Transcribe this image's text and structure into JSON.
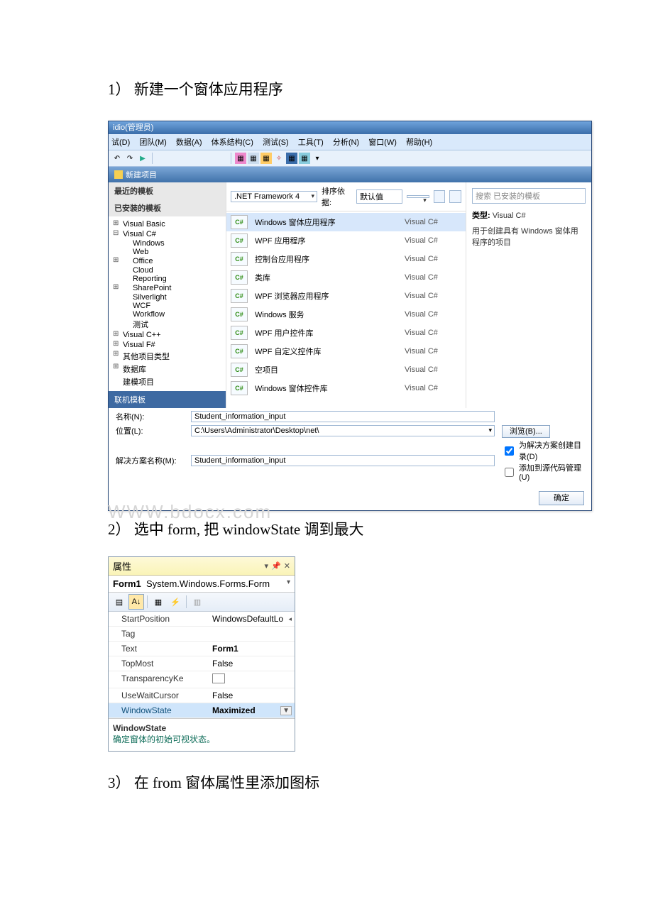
{
  "steps": {
    "s1": "1） 新建一个窗体应用程序",
    "s2": "2） 选中 form, 把 windowState 调到最大",
    "s3": "3） 在 from 窗体属性里添加图标"
  },
  "watermark": "WWW.bdocx.com",
  "newproj": {
    "titlebar": "idio(管理员)",
    "menu": {
      "debug": "试(D)",
      "team": "团队(M)",
      "data": "数据(A)",
      "arch": "体系结构(C)",
      "test": "测试(S)",
      "tools": "工具(T)",
      "analyze": "分析(N)",
      "window": "窗口(W)",
      "help": "帮助(H)"
    },
    "tab": "新建项目",
    "left": {
      "hdr_recent": "最近的模板",
      "hdr_installed": "已安装的模板",
      "items": {
        "vb": "Visual Basic",
        "cs": "Visual C#",
        "win": "Windows",
        "web": "Web",
        "office": "Office",
        "cloud": "Cloud",
        "reporting": "Reporting",
        "sharepoint": "SharePoint",
        "silverlight": "Silverlight",
        "wcf": "WCF",
        "workflow": "Workflow",
        "test": "测试",
        "cpp": "Visual C++",
        "fsharp": "Visual F#",
        "other_types": "其他项目类型",
        "database": "数据库",
        "modeling": "建模项目"
      },
      "footer": "联机模板"
    },
    "mid": {
      "framework": ".NET Framework 4",
      "sort_label": "排序依据:",
      "sort_value": "默认值",
      "templates": [
        {
          "name": "Windows 窗体应用程序",
          "lang": "Visual C#",
          "icon": "C#",
          "sel": true
        },
        {
          "name": "WPF 应用程序",
          "lang": "Visual C#",
          "icon": "C#"
        },
        {
          "name": "控制台应用程序",
          "lang": "Visual C#",
          "icon": "C#"
        },
        {
          "name": "类库",
          "lang": "Visual C#",
          "icon": "C#"
        },
        {
          "name": "WPF 浏览器应用程序",
          "lang": "Visual C#",
          "icon": "C#"
        },
        {
          "name": "Windows 服务",
          "lang": "Visual C#",
          "icon": "C#"
        },
        {
          "name": "WPF 用户控件库",
          "lang": "Visual C#",
          "icon": "C#"
        },
        {
          "name": "WPF 自定义控件库",
          "lang": "Visual C#",
          "icon": "C#"
        },
        {
          "name": "空项目",
          "lang": "Visual C#",
          "icon": "C#"
        },
        {
          "name": "Windows 窗体控件库",
          "lang": "Visual C#",
          "icon": "C#"
        }
      ]
    },
    "right": {
      "search_placeholder": "搜索 已安装的模板",
      "type_label": "类型:",
      "type_value": "Visual C#",
      "desc": "用于创建具有 Windows 窗体用程序的项目"
    },
    "footer": {
      "name_label": "名称(N):",
      "name_value": "Student_information_input",
      "loc_label": "位置(L):",
      "loc_value": "C:\\Users\\Administrator\\Desktop\\net\\",
      "sln_label": "解决方案名称(M):",
      "sln_value": "Student_information_input",
      "browse": "浏览(B)...",
      "chk1": "为解决方案创建目录(D)",
      "chk2": "添加到源代码管理(U)",
      "ok": "确定"
    }
  },
  "props": {
    "title": "属性",
    "obj_name": "Form1",
    "obj_type": "System.Windows.Forms.Form",
    "rows": [
      {
        "name": "StartPosition",
        "value": "WindowsDefaultLo",
        "arrow": true
      },
      {
        "name": "Tag",
        "value": ""
      },
      {
        "name": "Text",
        "value": "Form1",
        "bold": true
      },
      {
        "name": "TopMost",
        "value": "False"
      },
      {
        "name": "TransparencyKe",
        "value": "",
        "box": true
      },
      {
        "name": "UseWaitCursor",
        "value": "False"
      },
      {
        "name": "WindowState",
        "value": "Maximized",
        "bold": true,
        "dd": true,
        "sel": true
      }
    ],
    "desc_title": "WindowState",
    "desc_text": "确定窗体的初始可视状态。"
  }
}
